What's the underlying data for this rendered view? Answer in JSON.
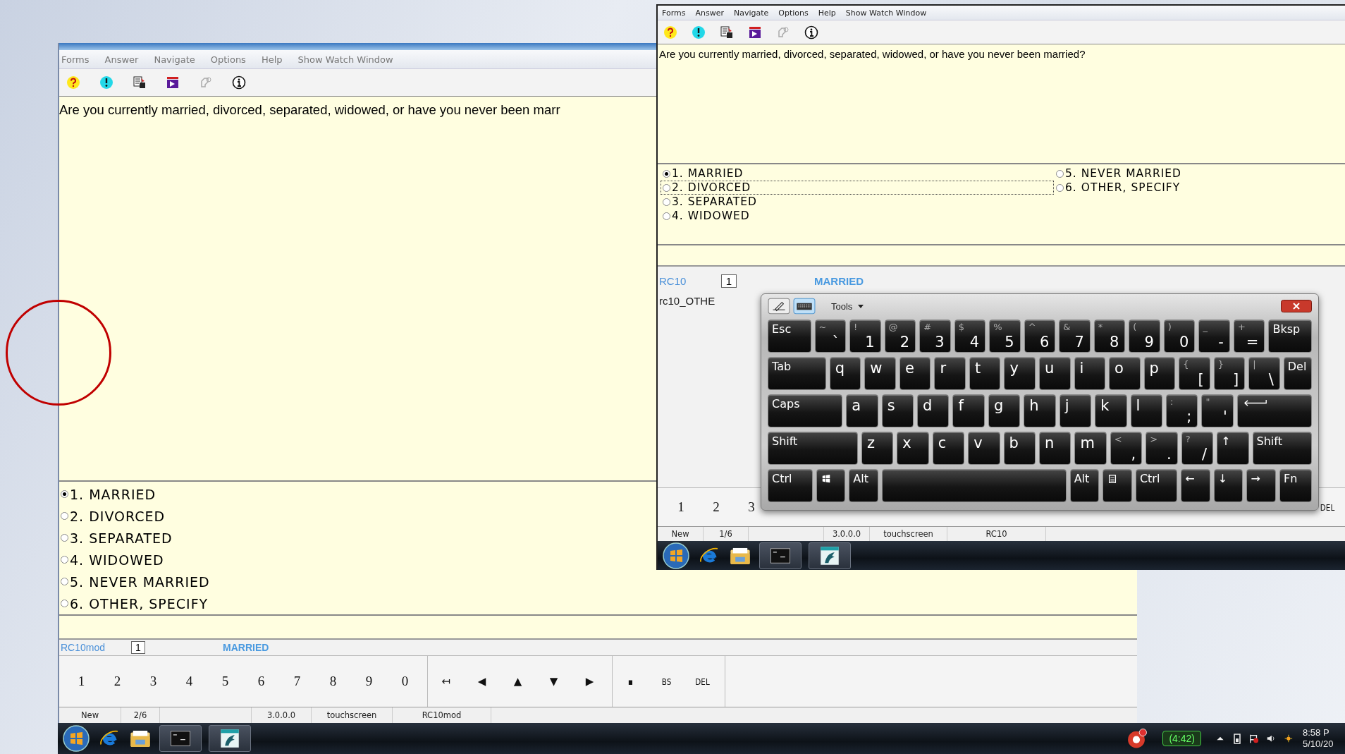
{
  "back_window": {
    "menu": [
      "Forms",
      "Answer",
      "Navigate",
      "Options",
      "Help",
      "Show Watch Window"
    ],
    "question": "Are you currently married, divorced, separated, widowed, or have you never been marr",
    "options": [
      {
        "label": "1. MARRIED",
        "selected": true
      },
      {
        "label": "2. DIVORCED",
        "selected": false
      },
      {
        "label": "3. SEPARATED",
        "selected": false
      },
      {
        "label": "4. WIDOWED",
        "selected": false
      },
      {
        "label": "5. NEVER MARRIED",
        "selected": false
      },
      {
        "label": "6. OTHER, SPECIFY",
        "selected": false
      }
    ],
    "field": {
      "name": "RC10mod",
      "value": "1",
      "answer": "MARRIED"
    },
    "keypad": {
      "digits": [
        "1",
        "2",
        "3",
        "4",
        "5",
        "6",
        "7",
        "8",
        "9",
        "0"
      ],
      "navigation": [
        "↤",
        "◀",
        "▲",
        "▼",
        "▶"
      ],
      "editing": [
        "▪",
        "BS",
        "DEL"
      ]
    },
    "status_bar": [
      "New",
      "2/6",
      "3.0.0.0",
      "touchscreen",
      "RC10mod"
    ]
  },
  "taskbar": {
    "battery_timer": "(4:42)",
    "clock_time": "8:58 P",
    "clock_date": "5/10/20"
  },
  "front_window": {
    "menu": [
      "Forms",
      "Answer",
      "Navigate",
      "Options",
      "Help",
      "Show Watch Window"
    ],
    "question": "Are you currently married, divorced, separated, widowed, or have you never been married?",
    "options": [
      {
        "label": "1. MARRIED",
        "selected": true,
        "focused": false
      },
      {
        "label": "2. DIVORCED",
        "selected": false,
        "focused": true
      },
      {
        "label": "3. SEPARATED",
        "selected": false,
        "focused": false
      },
      {
        "label": "4. WIDOWED",
        "selected": false,
        "focused": false
      },
      {
        "label": "5. NEVER MARRIED",
        "selected": false,
        "focused": false
      },
      {
        "label": "6. OTHER, SPECIFY",
        "selected": false,
        "focused": false
      }
    ],
    "fields": [
      {
        "name": "RC10",
        "value": "1",
        "answer": "MARRIED"
      },
      {
        "name": "rc10_OTHE"
      }
    ],
    "keypad": {
      "digits": [
        "1",
        "2",
        "3"
      ],
      "editing": [
        "DEL"
      ]
    },
    "status_bar": [
      "New",
      "1/6",
      "3.0.0.0",
      "touchscreen",
      "RC10"
    ]
  },
  "keyboard": {
    "tools": "Tools",
    "number_row": [
      {
        "kind": "function",
        "label": "Esc"
      },
      {
        "kind": "pair",
        "shift": "~",
        "label": "`"
      },
      {
        "kind": "pair",
        "shift": "!",
        "label": "1"
      },
      {
        "kind": "pair",
        "shift": "@",
        "label": "2"
      },
      {
        "kind": "pair",
        "shift": "#",
        "label": "3"
      },
      {
        "kind": "pair",
        "shift": "$",
        "label": "4"
      },
      {
        "kind": "pair",
        "shift": "%",
        "label": "5"
      },
      {
        "kind": "pair",
        "shift": "^",
        "label": "6"
      },
      {
        "kind": "pair",
        "shift": "&",
        "label": "7"
      },
      {
        "kind": "pair",
        "shift": "*",
        "label": "8"
      },
      {
        "kind": "pair",
        "shift": "(",
        "label": "9"
      },
      {
        "kind": "pair",
        "shift": ")",
        "label": "0"
      },
      {
        "kind": "pair",
        "shift": "_",
        "label": "-"
      },
      {
        "kind": "pair",
        "shift": "+",
        "label": "="
      },
      {
        "kind": "function",
        "label": "Bksp"
      }
    ],
    "top_row": [
      {
        "kind": "function",
        "label": "Tab"
      },
      {
        "kind": "letter",
        "label": "q"
      },
      {
        "kind": "letter",
        "label": "w"
      },
      {
        "kind": "letter",
        "label": "e"
      },
      {
        "kind": "letter",
        "label": "r"
      },
      {
        "kind": "letter",
        "label": "t"
      },
      {
        "kind": "letter",
        "label": "y"
      },
      {
        "kind": "letter",
        "label": "u"
      },
      {
        "kind": "letter",
        "label": "i"
      },
      {
        "kind": "letter",
        "label": "o"
      },
      {
        "kind": "letter",
        "label": "p"
      },
      {
        "kind": "pair",
        "shift": "{",
        "label": "["
      },
      {
        "kind": "pair",
        "shift": "}",
        "label": "]"
      },
      {
        "kind": "pair",
        "shift": "|",
        "label": "\\"
      },
      {
        "kind": "function",
        "label": "Del"
      }
    ],
    "home_row": [
      {
        "kind": "function",
        "label": "Caps"
      },
      {
        "kind": "letter",
        "label": "a"
      },
      {
        "kind": "letter",
        "label": "s"
      },
      {
        "kind": "letter",
        "label": "d"
      },
      {
        "kind": "letter",
        "label": "f"
      },
      {
        "kind": "letter",
        "label": "g"
      },
      {
        "kind": "letter",
        "label": "h"
      },
      {
        "kind": "letter",
        "label": "j"
      },
      {
        "kind": "letter",
        "label": "k"
      },
      {
        "kind": "letter",
        "label": "l"
      },
      {
        "kind": "pair",
        "shift": ":",
        "label": ";"
      },
      {
        "kind": "pair",
        "shift": "\"",
        "label": "'"
      },
      {
        "kind": "enter"
      }
    ],
    "shift_row": [
      {
        "kind": "function",
        "label": "Shift"
      },
      {
        "kind": "letter",
        "label": "z"
      },
      {
        "kind": "letter",
        "label": "x"
      },
      {
        "kind": "letter",
        "label": "c"
      },
      {
        "kind": "letter",
        "label": "v"
      },
      {
        "kind": "letter",
        "label": "b"
      },
      {
        "kind": "letter",
        "label": "n"
      },
      {
        "kind": "letter",
        "label": "m"
      },
      {
        "kind": "pair",
        "shift": "<",
        "label": ","
      },
      {
        "kind": "pair",
        "shift": ">",
        "label": "."
      },
      {
        "kind": "pair",
        "shift": "?",
        "label": "/"
      },
      {
        "kind": "function",
        "label": "↑"
      },
      {
        "kind": "function",
        "label": "Shift"
      }
    ],
    "control_row": [
      {
        "kind": "function",
        "label": "Ctrl"
      },
      {
        "kind": "logo"
      },
      {
        "kind": "function",
        "label": "Alt"
      },
      {
        "kind": "space"
      },
      {
        "kind": "function",
        "label": "Alt"
      },
      {
        "kind": "menu"
      },
      {
        "kind": "function",
        "label": "Ctrl"
      },
      {
        "kind": "function",
        "label": "←"
      },
      {
        "kind": "function",
        "label": "↓"
      },
      {
        "kind": "function",
        "label": "→"
      },
      {
        "kind": "function",
        "label": "Fn"
      }
    ]
  }
}
